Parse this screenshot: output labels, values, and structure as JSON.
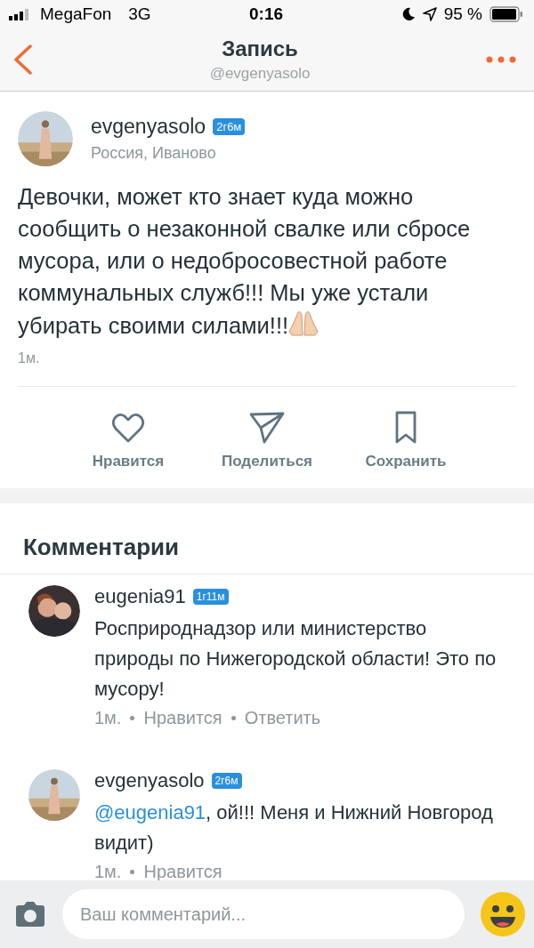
{
  "status_bar": {
    "carrier": "MegaFon",
    "network": "3G",
    "time": "0:16",
    "battery_percent": "95 %"
  },
  "nav": {
    "title": "Запись",
    "subtitle": "@evgenyasolo"
  },
  "post": {
    "author": "evgenyasolo",
    "badge": "2г6м",
    "location": "Россия, Иваново",
    "text": "Девочки, может кто знает куда можно сообщить о незаконной свалке или сбросе мусора, или о недобросовестной работе коммунальных служб!!! Мы уже устали убирать своими силами!!!",
    "time": "1м."
  },
  "actions": [
    {
      "kind": "like",
      "label": "Нравится"
    },
    {
      "kind": "share",
      "label": "Поделиться"
    },
    {
      "kind": "save",
      "label": "Сохранить"
    }
  ],
  "comments_title": "Комментарии",
  "comments": [
    {
      "author": "eugenia91",
      "badge": "1г11м",
      "text": "Росприроднадзор или министерство природы по Нижегородской области! Это по мусору!",
      "time": "1м.",
      "like": "Нравится",
      "reply": "Ответить"
    },
    {
      "author": "evgenyasolo",
      "badge": "2г6м",
      "mention": "@eugenia91",
      "text": ", ой!!! Меня и Нижний Новгород видит)",
      "time": "1м.",
      "like": "Нравится"
    }
  ],
  "composer": {
    "placeholder": "Ваш комментарий..."
  }
}
